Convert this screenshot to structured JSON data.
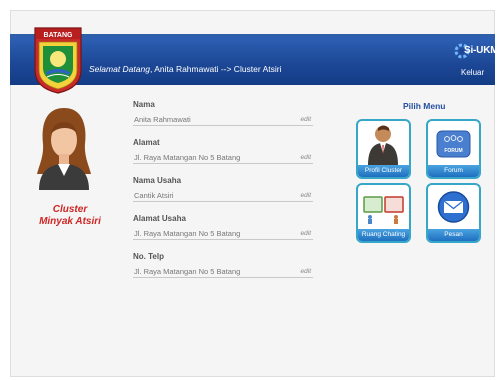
{
  "header": {
    "welcome_prefix": "Selamat Datang",
    "welcome_rest": ", Anita Rahmawati --> Cluster Atsiri",
    "logo_text": "BATANG",
    "brand": "Si-UKM",
    "logout": "Keluar"
  },
  "profile": {
    "cluster_line1": "Cluster",
    "cluster_line2": "Minyak Atsiri"
  },
  "fields": [
    {
      "label": "Nama",
      "value": "Anita Rahmawati",
      "edit": "edit"
    },
    {
      "label": "Alamat",
      "value": "Jl. Raya Matangan No 5 Batang",
      "edit": "edit"
    },
    {
      "label": "Nama Usaha",
      "value": "Cantik Atsiri",
      "edit": "edit"
    },
    {
      "label": "Alamat Usaha",
      "value": "Jl. Raya Matangan No 5 Batang",
      "edit": "edit"
    },
    {
      "label": "No. Telp",
      "value": "Jl. Raya Matangan No 5 Batang",
      "edit": "edit"
    }
  ],
  "menu": {
    "title": "Pilih Menu",
    "items": [
      {
        "label": "Profil Cluster",
        "icon": "person-icon"
      },
      {
        "label": "Forum",
        "icon": "forum-icon",
        "icon_text": "FORUM"
      },
      {
        "label": "Ruang Chating",
        "icon": "chat-icon"
      },
      {
        "label": "Pesan",
        "icon": "envelope-icon"
      }
    ]
  },
  "colors": {
    "header": "#1d4897",
    "accent_red": "#d02525",
    "tile_border": "#36a7c9",
    "menu_title": "#2350a0"
  }
}
